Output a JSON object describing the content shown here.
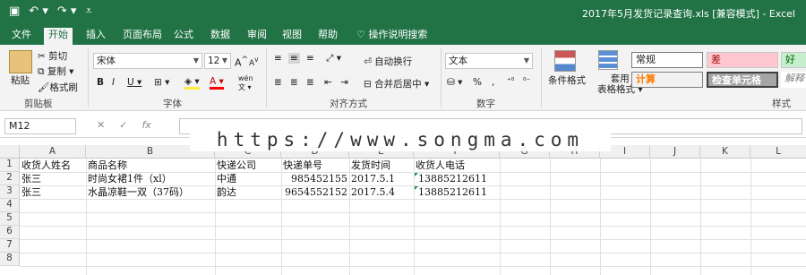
{
  "window": {
    "title": "2017年5月发货记录查询.xls [兼容模式] - Excel"
  },
  "qat": {
    "save_icon": "save-icon",
    "undo_icon": "undo-icon",
    "redo_icon": "redo-icon",
    "customize_icon": "customize-icon"
  },
  "tabs": [
    {
      "label": "文件"
    },
    {
      "label": "开始"
    },
    {
      "label": "插入"
    },
    {
      "label": "页面布局"
    },
    {
      "label": "公式"
    },
    {
      "label": "数据"
    },
    {
      "label": "审阅"
    },
    {
      "label": "视图"
    },
    {
      "label": "帮助"
    },
    {
      "label": "操作说明搜索"
    }
  ],
  "ribbon": {
    "clipboard": {
      "paste": "粘贴",
      "cut": "剪切",
      "copy": "复制",
      "format_painter": "格式刷",
      "label": "剪贴板"
    },
    "font": {
      "font_name": "宋体",
      "font_size": "12",
      "grow": "A",
      "shrink": "A",
      "bold": "B",
      "italic": "I",
      "underline": "U",
      "phonetic": "wén",
      "label": "字体"
    },
    "alignment": {
      "wrap_text": "自动换行",
      "merge_center": "合并后居中",
      "label": "对齐方式"
    },
    "number": {
      "format": "文本",
      "percent": "%",
      "comma": ",",
      "label": "数字"
    },
    "styles": {
      "conditional": "条件格式",
      "table_format_1": "套用",
      "table_format_2": "表格格式",
      "normal": "常规",
      "bad": "差",
      "good": "好",
      "calc": "计算",
      "check_cell": "检查单元格",
      "explanatory": "解释",
      "label": "样式"
    }
  },
  "formula_bar": {
    "name_box": "M12",
    "cancel": "✕",
    "enter": "✓",
    "fx": "fx",
    "value": ""
  },
  "watermark": "https://www.songma.com",
  "columns": [
    "A",
    "B",
    "C",
    "D",
    "E",
    "F",
    "G",
    "H",
    "I",
    "J",
    "K",
    "L"
  ],
  "rows": [
    "1",
    "2",
    "3",
    "4",
    "5",
    "6",
    "7",
    "8"
  ],
  "sheet": {
    "header": [
      "收货人姓名",
      "商品名称",
      "快递公司",
      "快递单号",
      "发货时间",
      "收货人电话"
    ],
    "data": [
      [
        "张三",
        "时尚女裙1件（xl）",
        "中通",
        "985452155",
        "2017.5.1",
        "13885212611"
      ],
      [
        "张三",
        "水晶凉鞋一双（37码）",
        "韵达",
        "9654552152",
        "2017.5.4",
        "13885212611"
      ]
    ]
  }
}
